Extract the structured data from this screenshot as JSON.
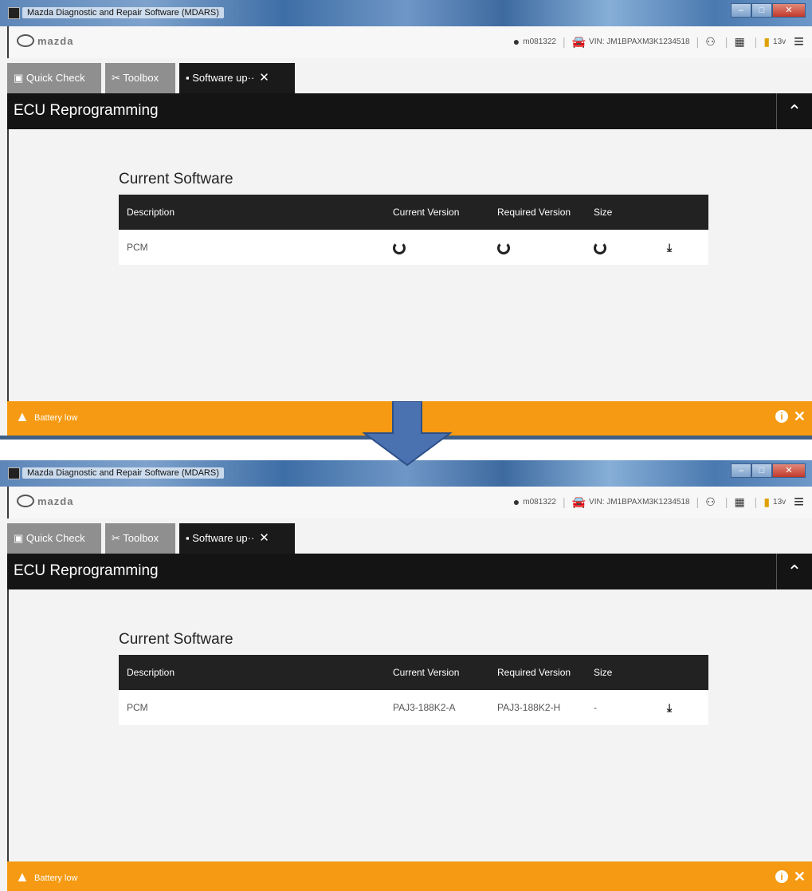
{
  "screens": [
    {
      "window_title": "Mazda Diagnostic and Repair Software (MDARS)",
      "logo_text": "mazda",
      "user": "m081322",
      "vin": "VIN: JM1BPAXM3K1234518",
      "voltage": "13v",
      "tabs": [
        {
          "label": "Quick Check"
        },
        {
          "label": "Toolbox"
        },
        {
          "label": "Software up··"
        }
      ],
      "section_title": "ECU Reprogramming",
      "current_software_title": "Current Software",
      "table": {
        "headers": [
          "Description",
          "Current Version",
          "Required Version",
          "Size"
        ],
        "rows": [
          {
            "description": "PCM",
            "current_version": "",
            "required_version": "",
            "size": "",
            "loading": true
          }
        ]
      },
      "status_message": "Battery low"
    },
    {
      "window_title": "Mazda Diagnostic and Repair Software (MDARS)",
      "logo_text": "mazda",
      "user": "m081322",
      "vin": "VIN: JM1BPAXM3K1234518",
      "voltage": "13v",
      "tabs": [
        {
          "label": "Quick Check"
        },
        {
          "label": "Toolbox"
        },
        {
          "label": "Software up··"
        }
      ],
      "section_title": "ECU Reprogramming",
      "current_software_title": "Current Software",
      "table": {
        "headers": [
          "Description",
          "Current Version",
          "Required Version",
          "Size"
        ],
        "rows": [
          {
            "description": "PCM",
            "current_version": "PAJ3-188K2-A",
            "required_version": "PAJ3-188K2-H",
            "size": "-",
            "loading": false
          }
        ]
      },
      "status_message": "Battery low"
    }
  ],
  "colors": {
    "status_bar": "#f59a12",
    "header_dark": "#141414",
    "arrow_fill": "#4a72b0",
    "arrow_stroke": "#2c4f88"
  },
  "icons": {
    "user": "user-icon",
    "car": "car-icon",
    "battery": "battery-icon",
    "menu": "hamburger-icon",
    "warning": "warning-icon",
    "download": "download-icon",
    "loading": "loading-spinner-icon",
    "transition": "down-arrow-icon"
  }
}
